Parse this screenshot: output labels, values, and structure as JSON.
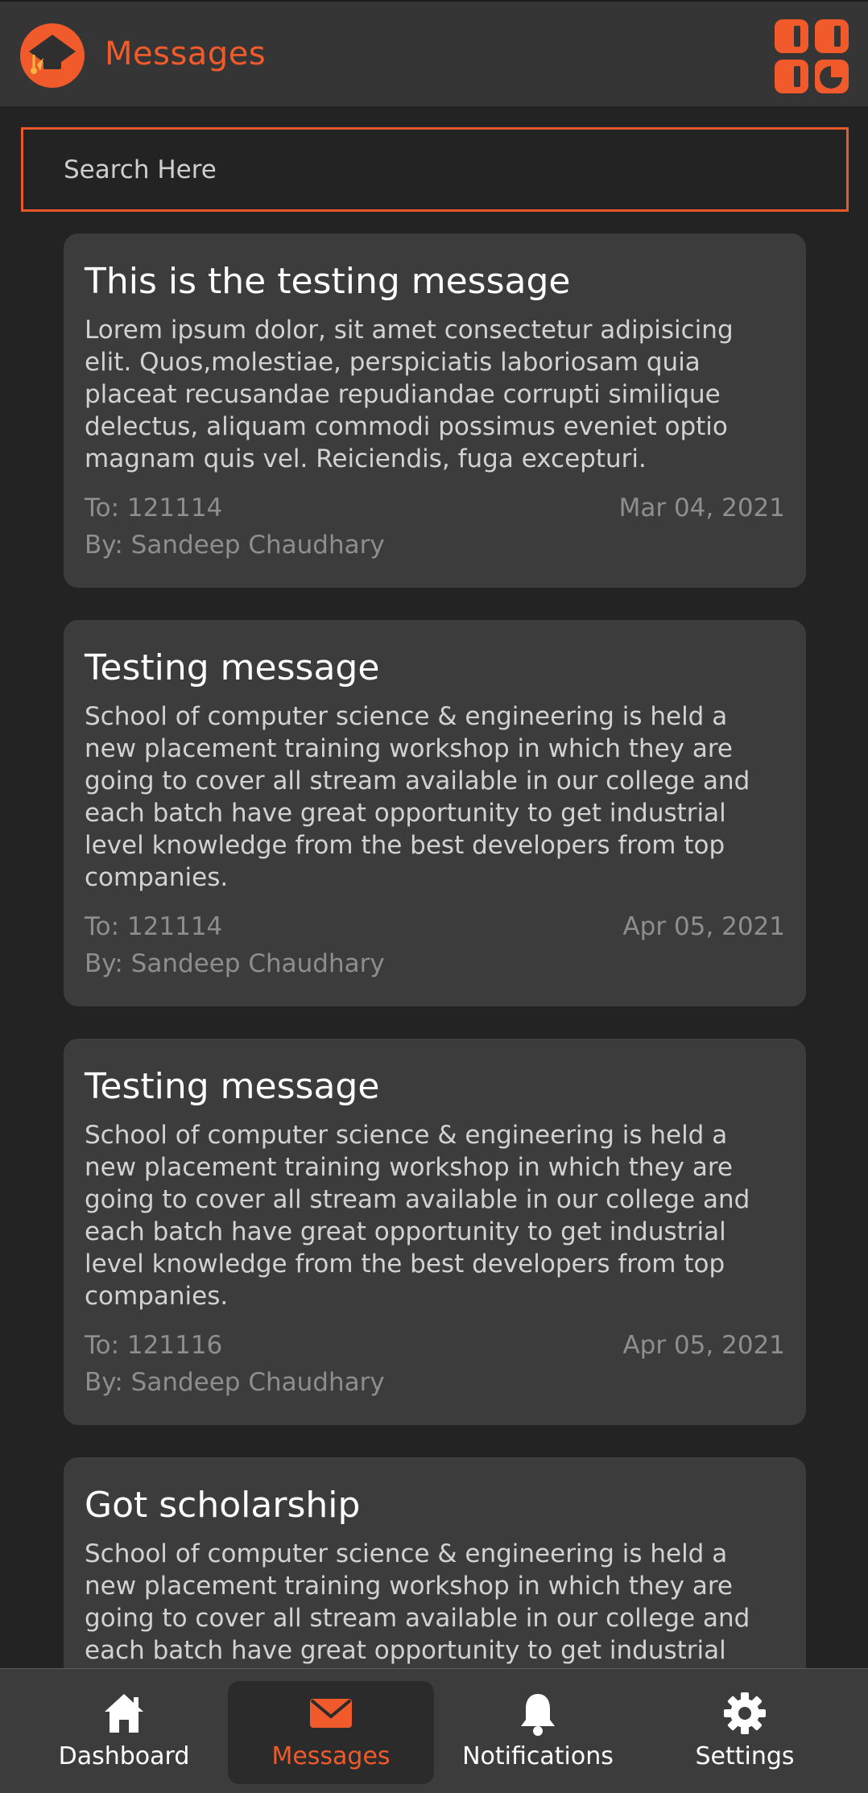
{
  "header": {
    "title": "Messages",
    "logo_icon": "graduation-cap-logo-icon",
    "menu_icon": "apps-grid-icon"
  },
  "search": {
    "placeholder": "Search Here"
  },
  "messages": [
    {
      "title": "This is the testing message",
      "body": "Lorem ipsum dolor, sit amet consectetur adipisicing elit. Quos,molestiae, perspiciatis laboriosam quia placeat recusandae repudiandae corrupti similique delectus, aliquam commodi possimus eveniet optio magnam quis vel. Reiciendis, fuga excepturi.",
      "to": "To: 121114",
      "date": "Mar 04, 2021",
      "by": "By: Sandeep Chaudhary"
    },
    {
      "title": "Testing message",
      "body": "School of computer science  & engineering is held a new placement  training  workshop in which they are going to cover all stream available in our college and each batch have great opportunity to get industrial level knowledge from the best developers  from top companies.",
      "to": "To: 121114",
      "date": "Apr 05, 2021",
      "by": "By: Sandeep Chaudhary"
    },
    {
      "title": "Testing message",
      "body": "School of computer science  & engineering is held a new placement  training  workshop in which they are going to cover all stream available in our college and each batch have great opportunity to get industrial level knowledge from the best developers  from top companies.",
      "to": "To: 121116",
      "date": "Apr 05, 2021",
      "by": "By: Sandeep Chaudhary"
    },
    {
      "title": "Got scholarship",
      "body": "School of computer science  & engineering is held a new placement  training  workshop in which they are going to cover all stream available in our college and each batch have great opportunity to get industrial"
    }
  ],
  "nav": [
    {
      "label": "Dashboard",
      "icon": "home-icon"
    },
    {
      "label": "Messages",
      "icon": "envelope-icon",
      "active": true
    },
    {
      "label": "Notifications",
      "icon": "bell-icon"
    },
    {
      "label": "Settings",
      "icon": "gear-icon"
    }
  ],
  "colors": {
    "accent": "#f15a2b",
    "background": "#232323",
    "card": "#3c3c3c",
    "header": "#353535"
  }
}
